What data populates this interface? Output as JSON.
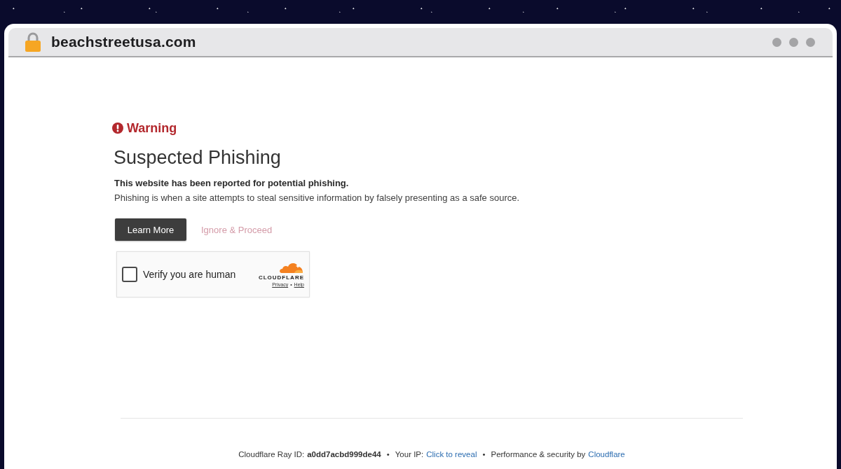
{
  "browser": {
    "url": "beachstreetusa.com",
    "secure": true
  },
  "page": {
    "warning_label": "Warning",
    "title": "Suspected Phishing",
    "lead": "This website has been reported for potential phishing.",
    "description": "Phishing is when a site attempts to steal sensitive information by falsely presenting as a safe source.",
    "buttons": [
      {
        "label": "Learn More",
        "kind": "primary"
      },
      {
        "label": "Ignore & Proceed",
        "kind": "link"
      }
    ],
    "captcha": {
      "label": "Verify you are human",
      "checked": false,
      "brand": "CLOUDFLARE",
      "links": [
        {
          "kind": "link",
          "text": "Privacy"
        },
        {
          "kind": "separator",
          "text": "•"
        },
        {
          "kind": "link",
          "text": "Help"
        }
      ]
    }
  },
  "footer": {
    "segments": [
      {
        "kind": "text",
        "text": "Cloudflare Ray ID:"
      },
      {
        "kind": "code",
        "text": "a0dd7acbd999de44"
      },
      {
        "kind": "separator",
        "text": "•"
      },
      {
        "kind": "text",
        "text": "Your IP:"
      },
      {
        "kind": "link",
        "text": "Click to reveal"
      },
      {
        "kind": "separator",
        "text": "•"
      },
      {
        "kind": "text",
        "text": "Performance & security by"
      },
      {
        "kind": "link",
        "text": "Cloudflare"
      }
    ]
  }
}
